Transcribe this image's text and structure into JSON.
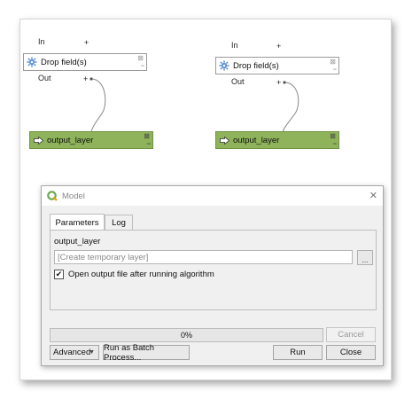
{
  "model": {
    "left": {
      "in_label": "In",
      "in_plus": "+",
      "node_label": "Drop field(s)",
      "out_label": "Out",
      "out_plus": "+",
      "output_label": "output_layer"
    },
    "right": {
      "in_label": "In",
      "in_plus": "+",
      "node_label": "Drop field(s)",
      "out_label": "Out",
      "out_plus": "+",
      "output_label": "output_layer"
    },
    "colors": {
      "output_node": "#8eb35a",
      "algorithm_node": "#ffffff"
    },
    "icons": {
      "algorithm": "gear-icon",
      "output": "arrow-right-icon",
      "node_controls": "close-icon"
    }
  },
  "dialog": {
    "title": "Model",
    "close_glyph": "✕",
    "tabs": [
      "Parameters",
      "Log"
    ],
    "active_tab": "Parameters",
    "output_label": "output_layer",
    "destination_value": "[Create temporary layer]",
    "browse_label": "...",
    "checkbox_label": "Open output file after running algorithm",
    "checkbox_checked": true,
    "check_glyph": "✔",
    "progress_text": "0%",
    "progress_value": 0,
    "buttons": {
      "cancel": "Cancel",
      "advanced": "Advanced",
      "batch": "Run as Batch Process...",
      "run": "Run",
      "close": "Close"
    }
  }
}
